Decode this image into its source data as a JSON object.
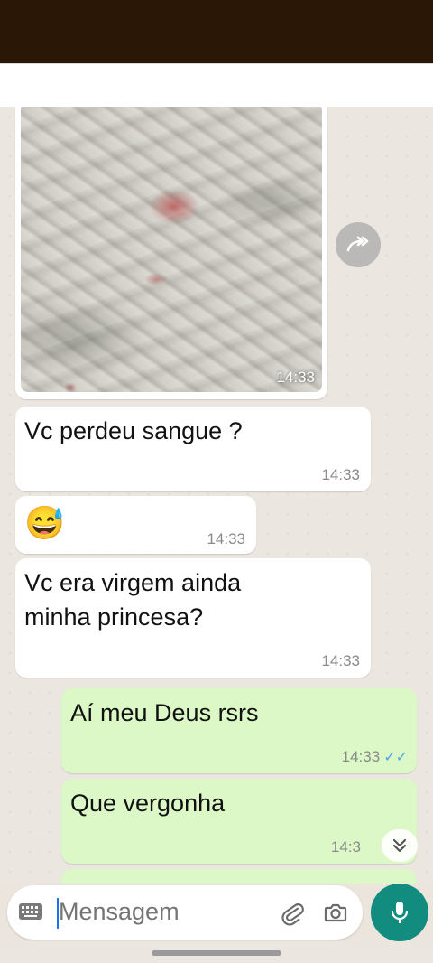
{
  "messages": [
    {
      "type": "image",
      "direction": "in",
      "time": "14:33"
    },
    {
      "type": "text",
      "direction": "in",
      "lines": [
        "Vc perdeu sangue ?"
      ],
      "time": "14:33"
    },
    {
      "type": "emoji",
      "direction": "in",
      "emoji": "😅",
      "time": "14:33"
    },
    {
      "type": "text",
      "direction": "in",
      "lines": [
        "Vc era virgem ainda",
        "minha princesa?"
      ],
      "time": "14:33"
    },
    {
      "type": "text",
      "direction": "out",
      "lines": [
        "Aí meu Deus rsrs"
      ],
      "time": "14:33",
      "status": "read"
    },
    {
      "type": "text",
      "direction": "out",
      "lines": [
        "Que vergonha"
      ],
      "time": "14:3"
    }
  ],
  "composer": {
    "placeholder": "Mensagem"
  },
  "icons": {
    "forward": "forward-icon",
    "scroll_down": "chevron-double-down-icon",
    "keyboard": "keyboard-icon",
    "attach": "paperclip-icon",
    "camera": "camera-icon",
    "mic": "microphone-icon",
    "read_receipt": "double-check-icon"
  },
  "colors": {
    "incoming_bubble": "#ffffff",
    "outgoing_bubble": "#dcf8c6",
    "accent": "#128c7e",
    "read_check": "#4fa6e0",
    "status_bar": "#2b1706"
  }
}
